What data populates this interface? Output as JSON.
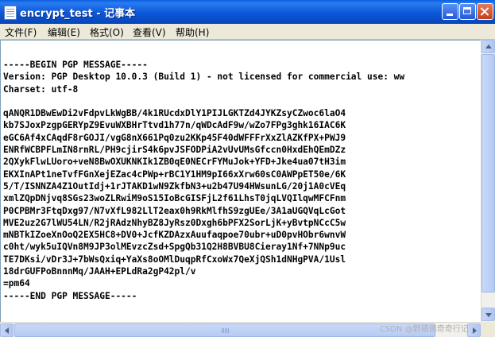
{
  "window": {
    "title": "encrypt_test - 记事本"
  },
  "menubar": {
    "file": "文件(F)",
    "edit": "编辑(E)",
    "format": "格式(O)",
    "view": "查看(V)",
    "help": "帮助(H)"
  },
  "editor": {
    "content": "-----BEGIN PGP MESSAGE-----\nVersion: PGP Desktop 10.0.3 (Build 1) - not licensed for commercial use: ww\nCharset: utf-8\n\nqANQR1DBwEwDi2vFdpvLkWgBB/4k1RUcdxDlY1PIJLGKTZd4JYKZsyCZwoc6laO4\nkb7SJoxPzgpGERYpZ9EvuWXBHrTtvd1h77n/qWDcAdF9w/wZo7FPg3ghk16IAC6K\neGC6Af4xCAqdF8rGOJI/vgG8nX661Pq0zu2KKp45F40dWFFFrXxZlAZKfPX+PWJ9\nENRfWCBPFLmIN8rnRL/PH9cjirS4k6pvJSFODPiA2vUvUMsGfccn0HxdEhQEmDZz\n2QXykFlwLUoro+veN8BwOXUKNKIk1ZB0qE0NECrFYMuJok+YFD+Jke4ua07tH3im\nEKXInAPt1neTvfFGnXejEZac4cPWp+rBC1Y1HM9pI66xXrw60sC0AWPpET50e/6K\n5/T/ISNNZA4Z1OutIdj+1rJTAKD1wN9ZkfbN3+u2b47U94HWsunLG/20j1A0cVEq\nxmlZQpDNjvq8SGs23woZLRwiM9oS15IoBcGISFjL2f61LhsT0jqLVQIlqwMFCFnm\nP0CPBMr3FtqDxg97/N7vXfL982LlT2eax0h9RkMlfhS9zgUEe/3A1aUGQVqLcGot\nMVE2uz2G7lWU54LN/R2jRAdzNhyBZ8JyRsz0Dxgh6bPFX2SorLjK+yBvtpNCcC5w\nmNBTkIZoeXnOoQ2EX5HC8+DV0+JcfKZDAzxAuufaqpoe70ubr+uD0pvHObr6wnvW\nc0ht/wyk5uIQVn8M9JP3olMEvzcZsd+SpgQb31Q2H8BVBU8Cieray1Nf+7NNp9uc\nTE7DKsi/vDr3J+7bWsQxiq+YaXs8oOMlDuqpRfCxoWx7QeXjQSh1dNHgPVA/1Usl\n18drGUFPoBnnnMq/JAAH+EPLdRa2gP42pl/v\n=pm64\n-----END PGP MESSAGE-----"
  },
  "watermark": {
    "text": "CSDN @野猪佩奇奇行记"
  },
  "icons": {
    "app": "notepad-icon",
    "minimize": "minimize-icon",
    "maximize": "maximize-icon",
    "close": "close-icon"
  }
}
